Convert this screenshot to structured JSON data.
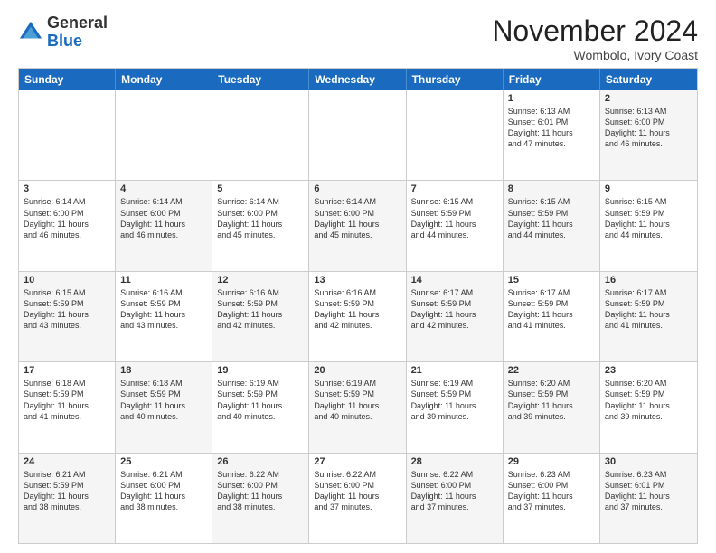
{
  "logo": {
    "general": "General",
    "blue": "Blue"
  },
  "title": "November 2024",
  "location": "Wombolo, Ivory Coast",
  "header_days": [
    "Sunday",
    "Monday",
    "Tuesday",
    "Wednesday",
    "Thursday",
    "Friday",
    "Saturday"
  ],
  "rows": [
    [
      {
        "day": "",
        "info": "",
        "shaded": false
      },
      {
        "day": "",
        "info": "",
        "shaded": false
      },
      {
        "day": "",
        "info": "",
        "shaded": false
      },
      {
        "day": "",
        "info": "",
        "shaded": false
      },
      {
        "day": "",
        "info": "",
        "shaded": false
      },
      {
        "day": "1",
        "info": "Sunrise: 6:13 AM\nSunset: 6:01 PM\nDaylight: 11 hours\nand 47 minutes.",
        "shaded": false
      },
      {
        "day": "2",
        "info": "Sunrise: 6:13 AM\nSunset: 6:00 PM\nDaylight: 11 hours\nand 46 minutes.",
        "shaded": true
      }
    ],
    [
      {
        "day": "3",
        "info": "Sunrise: 6:14 AM\nSunset: 6:00 PM\nDaylight: 11 hours\nand 46 minutes.",
        "shaded": false
      },
      {
        "day": "4",
        "info": "Sunrise: 6:14 AM\nSunset: 6:00 PM\nDaylight: 11 hours\nand 46 minutes.",
        "shaded": true
      },
      {
        "day": "5",
        "info": "Sunrise: 6:14 AM\nSunset: 6:00 PM\nDaylight: 11 hours\nand 45 minutes.",
        "shaded": false
      },
      {
        "day": "6",
        "info": "Sunrise: 6:14 AM\nSunset: 6:00 PM\nDaylight: 11 hours\nand 45 minutes.",
        "shaded": true
      },
      {
        "day": "7",
        "info": "Sunrise: 6:15 AM\nSunset: 5:59 PM\nDaylight: 11 hours\nand 44 minutes.",
        "shaded": false
      },
      {
        "day": "8",
        "info": "Sunrise: 6:15 AM\nSunset: 5:59 PM\nDaylight: 11 hours\nand 44 minutes.",
        "shaded": true
      },
      {
        "day": "9",
        "info": "Sunrise: 6:15 AM\nSunset: 5:59 PM\nDaylight: 11 hours\nand 44 minutes.",
        "shaded": false
      }
    ],
    [
      {
        "day": "10",
        "info": "Sunrise: 6:15 AM\nSunset: 5:59 PM\nDaylight: 11 hours\nand 43 minutes.",
        "shaded": true
      },
      {
        "day": "11",
        "info": "Sunrise: 6:16 AM\nSunset: 5:59 PM\nDaylight: 11 hours\nand 43 minutes.",
        "shaded": false
      },
      {
        "day": "12",
        "info": "Sunrise: 6:16 AM\nSunset: 5:59 PM\nDaylight: 11 hours\nand 42 minutes.",
        "shaded": true
      },
      {
        "day": "13",
        "info": "Sunrise: 6:16 AM\nSunset: 5:59 PM\nDaylight: 11 hours\nand 42 minutes.",
        "shaded": false
      },
      {
        "day": "14",
        "info": "Sunrise: 6:17 AM\nSunset: 5:59 PM\nDaylight: 11 hours\nand 42 minutes.",
        "shaded": true
      },
      {
        "day": "15",
        "info": "Sunrise: 6:17 AM\nSunset: 5:59 PM\nDaylight: 11 hours\nand 41 minutes.",
        "shaded": false
      },
      {
        "day": "16",
        "info": "Sunrise: 6:17 AM\nSunset: 5:59 PM\nDaylight: 11 hours\nand 41 minutes.",
        "shaded": true
      }
    ],
    [
      {
        "day": "17",
        "info": "Sunrise: 6:18 AM\nSunset: 5:59 PM\nDaylight: 11 hours\nand 41 minutes.",
        "shaded": false
      },
      {
        "day": "18",
        "info": "Sunrise: 6:18 AM\nSunset: 5:59 PM\nDaylight: 11 hours\nand 40 minutes.",
        "shaded": true
      },
      {
        "day": "19",
        "info": "Sunrise: 6:19 AM\nSunset: 5:59 PM\nDaylight: 11 hours\nand 40 minutes.",
        "shaded": false
      },
      {
        "day": "20",
        "info": "Sunrise: 6:19 AM\nSunset: 5:59 PM\nDaylight: 11 hours\nand 40 minutes.",
        "shaded": true
      },
      {
        "day": "21",
        "info": "Sunrise: 6:19 AM\nSunset: 5:59 PM\nDaylight: 11 hours\nand 39 minutes.",
        "shaded": false
      },
      {
        "day": "22",
        "info": "Sunrise: 6:20 AM\nSunset: 5:59 PM\nDaylight: 11 hours\nand 39 minutes.",
        "shaded": true
      },
      {
        "day": "23",
        "info": "Sunrise: 6:20 AM\nSunset: 5:59 PM\nDaylight: 11 hours\nand 39 minutes.",
        "shaded": false
      }
    ],
    [
      {
        "day": "24",
        "info": "Sunrise: 6:21 AM\nSunset: 5:59 PM\nDaylight: 11 hours\nand 38 minutes.",
        "shaded": true
      },
      {
        "day": "25",
        "info": "Sunrise: 6:21 AM\nSunset: 6:00 PM\nDaylight: 11 hours\nand 38 minutes.",
        "shaded": false
      },
      {
        "day": "26",
        "info": "Sunrise: 6:22 AM\nSunset: 6:00 PM\nDaylight: 11 hours\nand 38 minutes.",
        "shaded": true
      },
      {
        "day": "27",
        "info": "Sunrise: 6:22 AM\nSunset: 6:00 PM\nDaylight: 11 hours\nand 37 minutes.",
        "shaded": false
      },
      {
        "day": "28",
        "info": "Sunrise: 6:22 AM\nSunset: 6:00 PM\nDaylight: 11 hours\nand 37 minutes.",
        "shaded": true
      },
      {
        "day": "29",
        "info": "Sunrise: 6:23 AM\nSunset: 6:00 PM\nDaylight: 11 hours\nand 37 minutes.",
        "shaded": false
      },
      {
        "day": "30",
        "info": "Sunrise: 6:23 AM\nSunset: 6:01 PM\nDaylight: 11 hours\nand 37 minutes.",
        "shaded": true
      }
    ]
  ]
}
